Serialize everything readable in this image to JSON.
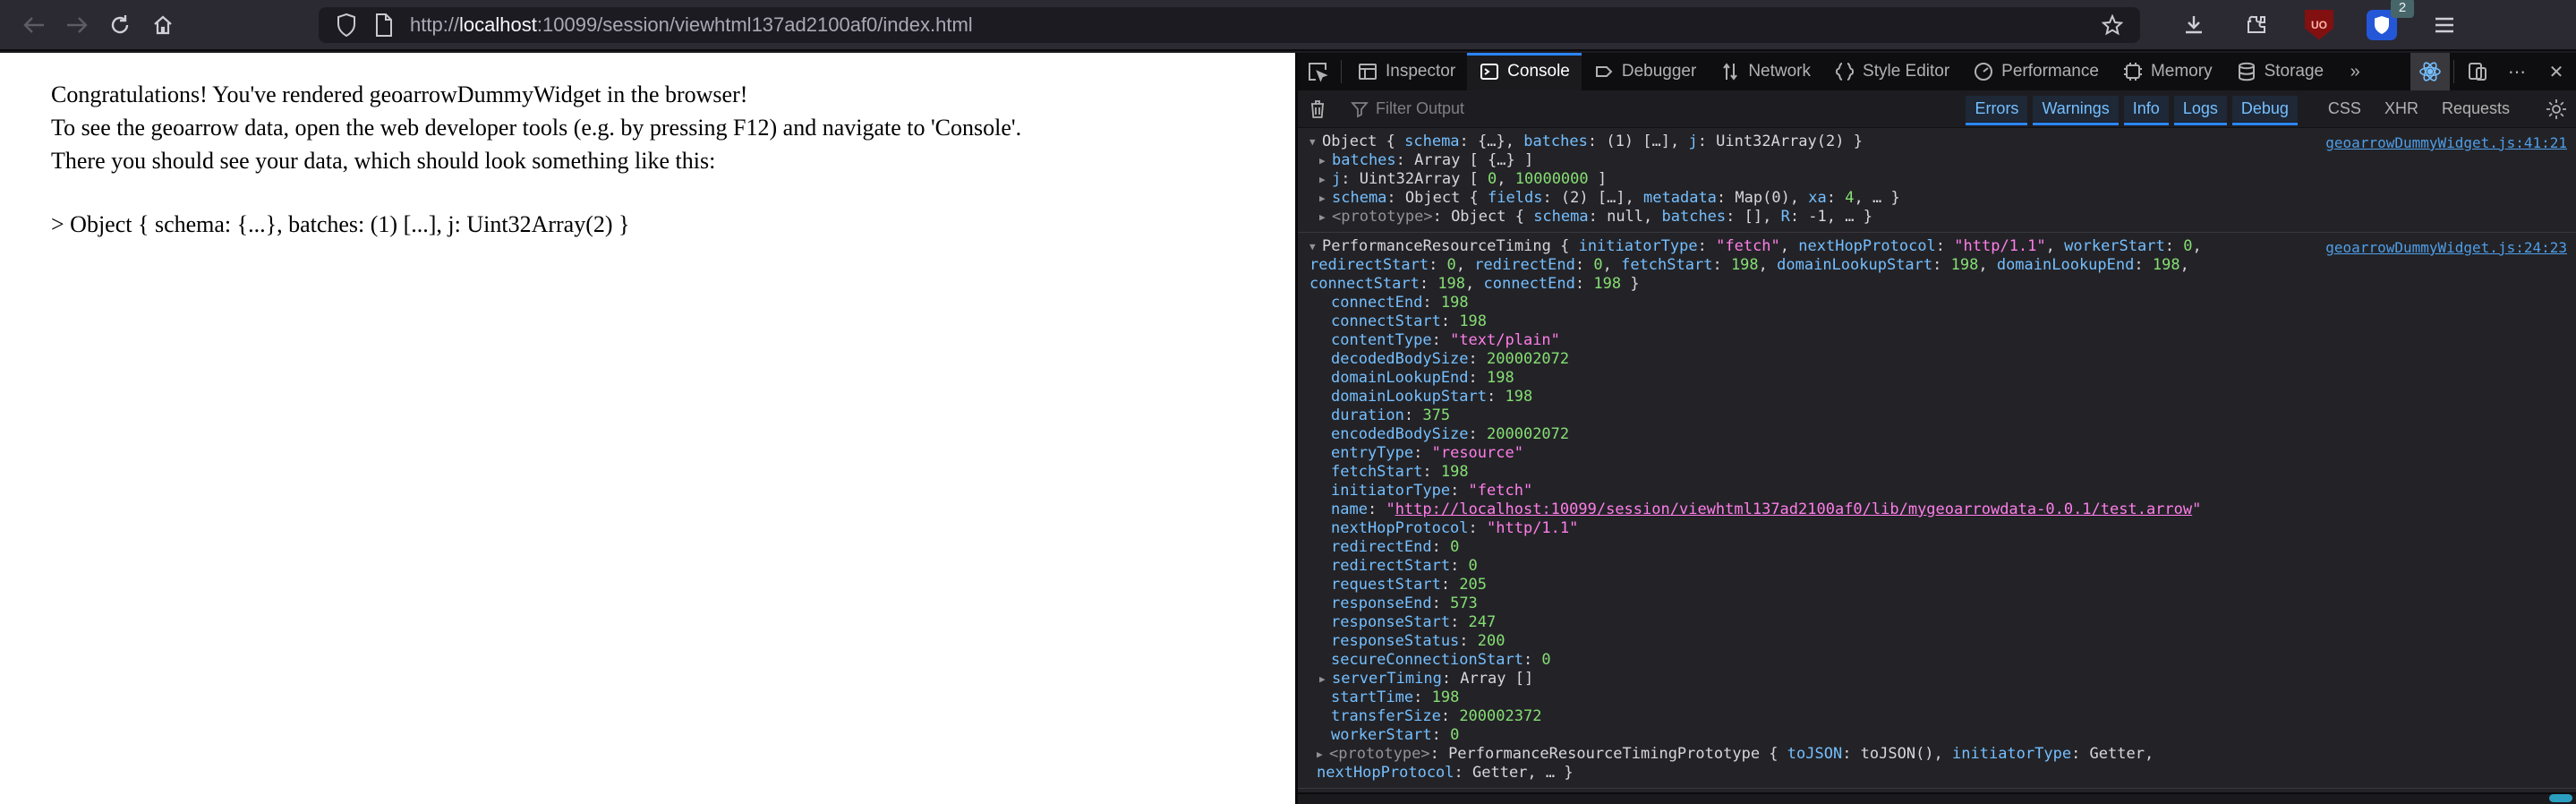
{
  "browser": {
    "url": {
      "scheme": "http://",
      "host": "localhost",
      "rest": ":10099/session/viewhtml137ad2100af0/index.html"
    },
    "extension_badge": "2",
    "ublock_label": "UO"
  },
  "page": {
    "line1": "Congratulations! You've rendered geoarrowDummyWidget in the browser!",
    "line2": "To see the geoarrow data, open the web developer tools (e.g. by pressing F12) and navigate to 'Console'.",
    "line3": "There you should see your data, which should look something like this:",
    "object_line": "> Object { schema: {...}, batches: (1) [...], j: Uint32Array(2) }"
  },
  "devtools": {
    "tabs": [
      {
        "label": "Inspector",
        "icon": "inspector",
        "active": false
      },
      {
        "label": "Console",
        "icon": "console",
        "active": true
      },
      {
        "label": "Debugger",
        "icon": "debugger",
        "active": false
      },
      {
        "label": "Network",
        "icon": "network",
        "active": false
      },
      {
        "label": "Style Editor",
        "icon": "style-editor",
        "active": false
      },
      {
        "label": "Performance",
        "icon": "performance",
        "active": false
      },
      {
        "label": "Memory",
        "icon": "memory",
        "active": false
      },
      {
        "label": "Storage",
        "icon": "storage",
        "active": false
      }
    ],
    "more_tabs_glyph": "»",
    "filter": {
      "placeholder": "Filter Output",
      "buttons_active": [
        "Errors",
        "Warnings",
        "Info",
        "Logs",
        "Debug"
      ],
      "buttons_inactive": [
        "CSS",
        "XHR",
        "Requests"
      ]
    },
    "colors": {
      "accent_blue": "#2b86ff",
      "key": "#75bfff",
      "number": "#86de74",
      "string": "#ff7de9",
      "location_link": "#4f9ee8",
      "text": "#d7d7db"
    },
    "console_entries": [
      {
        "location": "geoarrowDummyWidget.js:41:21",
        "preview": {
          "twisty": "open",
          "segs": [
            [
              "d",
              "Object { "
            ],
            [
              "k",
              "schema"
            ],
            [
              "d",
              ": {…}, "
            ],
            [
              "k",
              "batches"
            ],
            [
              "d",
              ": (1) […], "
            ],
            [
              "k",
              "j"
            ],
            [
              "d",
              ": Uint32Array(2) }"
            ]
          ]
        },
        "rows": [
          {
            "twisty": "closed",
            "segs": [
              [
                "k",
                "batches"
              ],
              [
                "d",
                ": Array [ {…} ]"
              ]
            ]
          },
          {
            "twisty": "closed",
            "segs": [
              [
                "k",
                "j"
              ],
              [
                "d",
                ": Uint32Array [ "
              ],
              [
                "n",
                "0"
              ],
              [
                "d",
                ", "
              ],
              [
                "n",
                "10000000"
              ],
              [
                "d",
                " ]"
              ]
            ]
          },
          {
            "twisty": "closed",
            "segs": [
              [
                "k",
                "schema"
              ],
              [
                "d",
                ": Object { "
              ],
              [
                "k",
                "fields"
              ],
              [
                "d",
                ": (2) […], "
              ],
              [
                "k",
                "metadata"
              ],
              [
                "d",
                ": Map(0), "
              ],
              [
                "k",
                "xa"
              ],
              [
                "d",
                ": "
              ],
              [
                "n",
                "4"
              ],
              [
                "d",
                ", … }"
              ]
            ]
          },
          {
            "twisty": "closed",
            "segs": [
              [
                "dim",
                "<prototype>"
              ],
              [
                "d",
                ": Object { "
              ],
              [
                "k",
                "schema"
              ],
              [
                "d",
                ": null, "
              ],
              [
                "k",
                "batches"
              ],
              [
                "d",
                ": [], "
              ],
              [
                "k",
                "R"
              ],
              [
                "d",
                ": -1, … }"
              ]
            ]
          }
        ]
      },
      {
        "location": "geoarrowDummyWidget.js:24:23",
        "preview": {
          "twisty": "open",
          "segs": [
            [
              "d",
              "PerformanceResourceTiming { "
            ],
            [
              "k",
              "initiatorType"
            ],
            [
              "d",
              ": "
            ],
            [
              "s",
              "\"fetch\""
            ],
            [
              "d",
              ", "
            ],
            [
              "k",
              "nextHopProtocol"
            ],
            [
              "d",
              ": "
            ],
            [
              "s",
              "\"http/1.1\""
            ],
            [
              "d",
              ", "
            ],
            [
              "k",
              "workerStart"
            ],
            [
              "d",
              ": "
            ],
            [
              "n",
              "0"
            ],
            [
              "d",
              ", "
            ],
            [
              "k",
              "redirectStart"
            ],
            [
              "d",
              ": "
            ],
            [
              "n",
              "0"
            ],
            [
              "d",
              ", "
            ],
            [
              "k",
              "redirectEnd"
            ],
            [
              "d",
              ": "
            ],
            [
              "n",
              "0"
            ],
            [
              "d",
              ", "
            ],
            [
              "k",
              "fetchStart"
            ],
            [
              "d",
              ": "
            ],
            [
              "n",
              "198"
            ],
            [
              "d",
              ", "
            ],
            [
              "k",
              "domainLookupStart"
            ],
            [
              "d",
              ": "
            ],
            [
              "n",
              "198"
            ],
            [
              "d",
              ", "
            ],
            [
              "k",
              "domainLookupEnd"
            ],
            [
              "d",
              ": "
            ],
            [
              "n",
              "198"
            ],
            [
              "d",
              ", "
            ],
            [
              "k",
              "connectStart"
            ],
            [
              "d",
              ": "
            ],
            [
              "n",
              "198"
            ],
            [
              "d",
              ", "
            ],
            [
              "k",
              "connectEnd"
            ],
            [
              "d",
              ": "
            ],
            [
              "n",
              "198"
            ],
            [
              "d",
              " }"
            ]
          ]
        },
        "rows": [
          {
            "segs": [
              [
                "k",
                "connectEnd"
              ],
              [
                "d",
                ": "
              ],
              [
                "n",
                "198"
              ]
            ]
          },
          {
            "segs": [
              [
                "k",
                "connectStart"
              ],
              [
                "d",
                ": "
              ],
              [
                "n",
                "198"
              ]
            ]
          },
          {
            "segs": [
              [
                "k",
                "contentType"
              ],
              [
                "d",
                ": "
              ],
              [
                "s",
                "\"text/plain\""
              ]
            ]
          },
          {
            "segs": [
              [
                "k",
                "decodedBodySize"
              ],
              [
                "d",
                ": "
              ],
              [
                "n",
                "200002072"
              ]
            ]
          },
          {
            "segs": [
              [
                "k",
                "domainLookupEnd"
              ],
              [
                "d",
                ": "
              ],
              [
                "n",
                "198"
              ]
            ]
          },
          {
            "segs": [
              [
                "k",
                "domainLookupStart"
              ],
              [
                "d",
                ": "
              ],
              [
                "n",
                "198"
              ]
            ]
          },
          {
            "segs": [
              [
                "k",
                "duration"
              ],
              [
                "d",
                ": "
              ],
              [
                "n",
                "375"
              ]
            ]
          },
          {
            "segs": [
              [
                "k",
                "encodedBodySize"
              ],
              [
                "d",
                ": "
              ],
              [
                "n",
                "200002072"
              ]
            ]
          },
          {
            "segs": [
              [
                "k",
                "entryType"
              ],
              [
                "d",
                ": "
              ],
              [
                "s",
                "\"resource\""
              ]
            ]
          },
          {
            "segs": [
              [
                "k",
                "fetchStart"
              ],
              [
                "d",
                ": "
              ],
              [
                "n",
                "198"
              ]
            ]
          },
          {
            "segs": [
              [
                "k",
                "initiatorType"
              ],
              [
                "d",
                ": "
              ],
              [
                "s",
                "\"fetch\""
              ]
            ]
          },
          {
            "segs": [
              [
                "k",
                "name"
              ],
              [
                "d",
                ": "
              ],
              [
                "s",
                "\""
              ],
              [
                "slnk",
                "http://localhost:10099/session/viewhtml137ad2100af0/lib/mygeoarrowdata-0.0.1/test.arrow"
              ],
              [
                "s",
                "\""
              ]
            ]
          },
          {
            "segs": [
              [
                "k",
                "nextHopProtocol"
              ],
              [
                "d",
                ": "
              ],
              [
                "s",
                "\"http/1.1\""
              ]
            ]
          },
          {
            "segs": [
              [
                "k",
                "redirectEnd"
              ],
              [
                "d",
                ": "
              ],
              [
                "n",
                "0"
              ]
            ]
          },
          {
            "segs": [
              [
                "k",
                "redirectStart"
              ],
              [
                "d",
                ": "
              ],
              [
                "n",
                "0"
              ]
            ]
          },
          {
            "segs": [
              [
                "k",
                "requestStart"
              ],
              [
                "d",
                ": "
              ],
              [
                "n",
                "205"
              ]
            ]
          },
          {
            "segs": [
              [
                "k",
                "responseEnd"
              ],
              [
                "d",
                ": "
              ],
              [
                "n",
                "573"
              ]
            ]
          },
          {
            "segs": [
              [
                "k",
                "responseStart"
              ],
              [
                "d",
                ": "
              ],
              [
                "n",
                "247"
              ]
            ]
          },
          {
            "segs": [
              [
                "k",
                "responseStatus"
              ],
              [
                "d",
                ": "
              ],
              [
                "n",
                "200"
              ]
            ]
          },
          {
            "segs": [
              [
                "k",
                "secureConnectionStart"
              ],
              [
                "d",
                ": "
              ],
              [
                "n",
                "0"
              ]
            ]
          },
          {
            "twisty": "closed",
            "segs": [
              [
                "k",
                "serverTiming"
              ],
              [
                "d",
                ": Array []"
              ]
            ]
          },
          {
            "segs": [
              [
                "k",
                "startTime"
              ],
              [
                "d",
                ": "
              ],
              [
                "n",
                "198"
              ]
            ]
          },
          {
            "segs": [
              [
                "k",
                "transferSize"
              ],
              [
                "d",
                ": "
              ],
              [
                "n",
                "200002372"
              ]
            ]
          },
          {
            "segs": [
              [
                "k",
                "workerStart"
              ],
              [
                "d",
                ": "
              ],
              [
                "n",
                "0"
              ]
            ]
          },
          {
            "twisty": "closed",
            "wrap": true,
            "segs": [
              [
                "dim",
                "<prototype>"
              ],
              [
                "d",
                ": PerformanceResourceTimingPrototype { "
              ],
              [
                "k",
                "toJSON"
              ],
              [
                "d",
                ": toJSON(), "
              ],
              [
                "k",
                "initiatorType"
              ],
              [
                "d",
                ": Getter, "
              ],
              [
                "k",
                "nextHopProtocol"
              ],
              [
                "d",
                ": Getter, … }"
              ]
            ]
          }
        ]
      }
    ]
  }
}
